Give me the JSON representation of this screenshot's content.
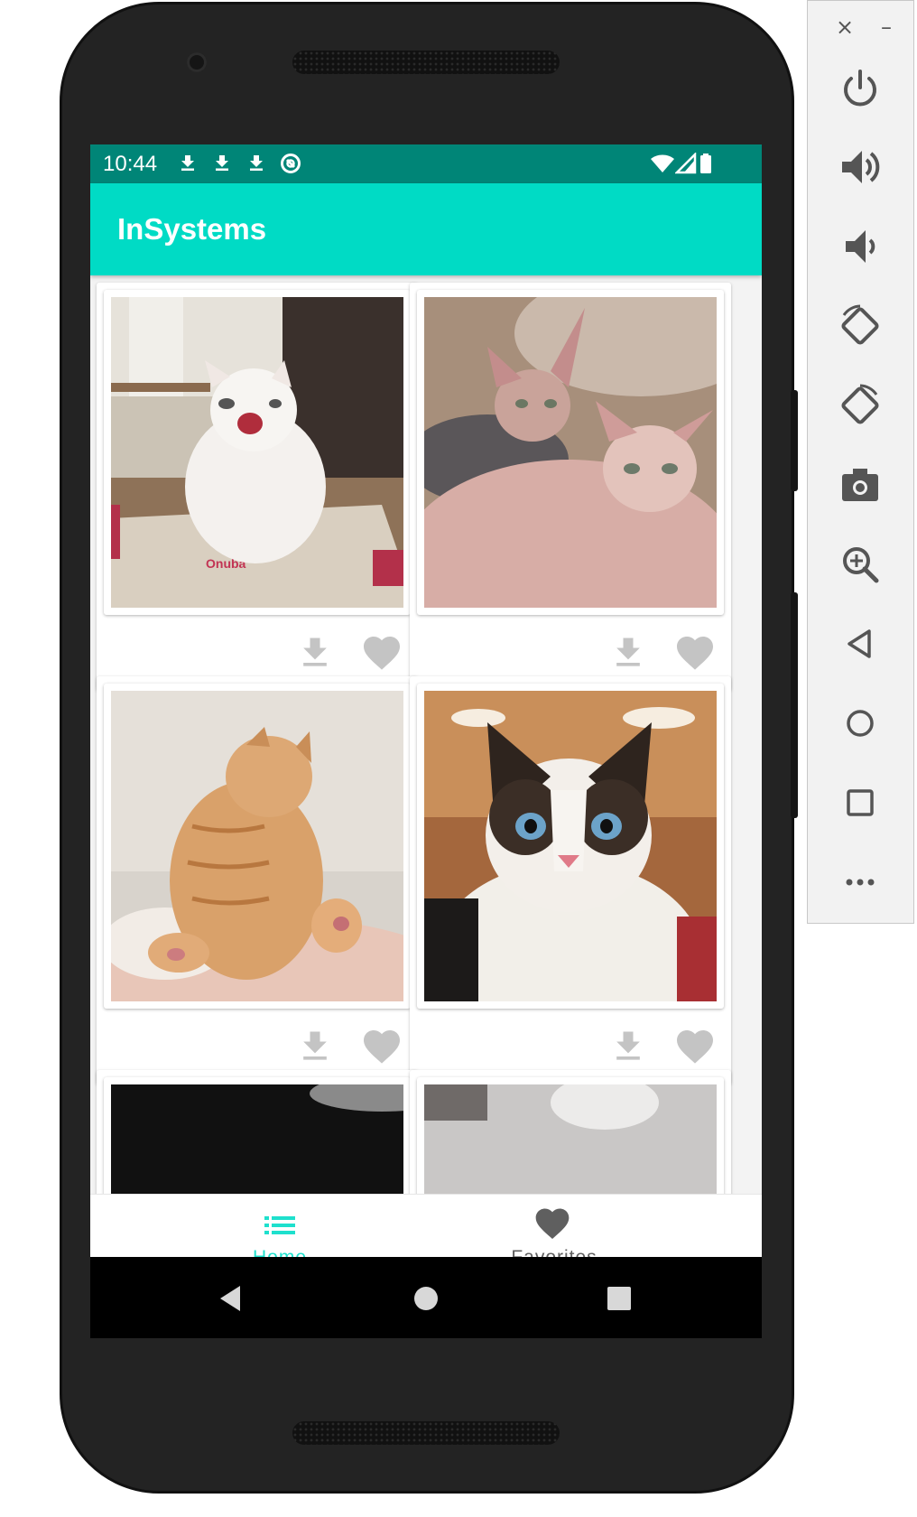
{
  "status_bar": {
    "time": "10:44"
  },
  "app_bar": {
    "title": "InSystems"
  },
  "cards": [
    {
      "photo": "white cat yawning in box"
    },
    {
      "photo": "two sphynx cats"
    },
    {
      "photo": "orange tabby cat grooming"
    },
    {
      "photo": "ragdoll cat with blue eyes"
    }
  ],
  "bottom_nav": {
    "home_label": "Home",
    "favorites_label": "Favorites"
  },
  "colors": {
    "status_bar": "#008577",
    "app_bar": "#00dbc5",
    "accent": "#1ee0cd",
    "icon_gray": "#c4c4c4"
  }
}
